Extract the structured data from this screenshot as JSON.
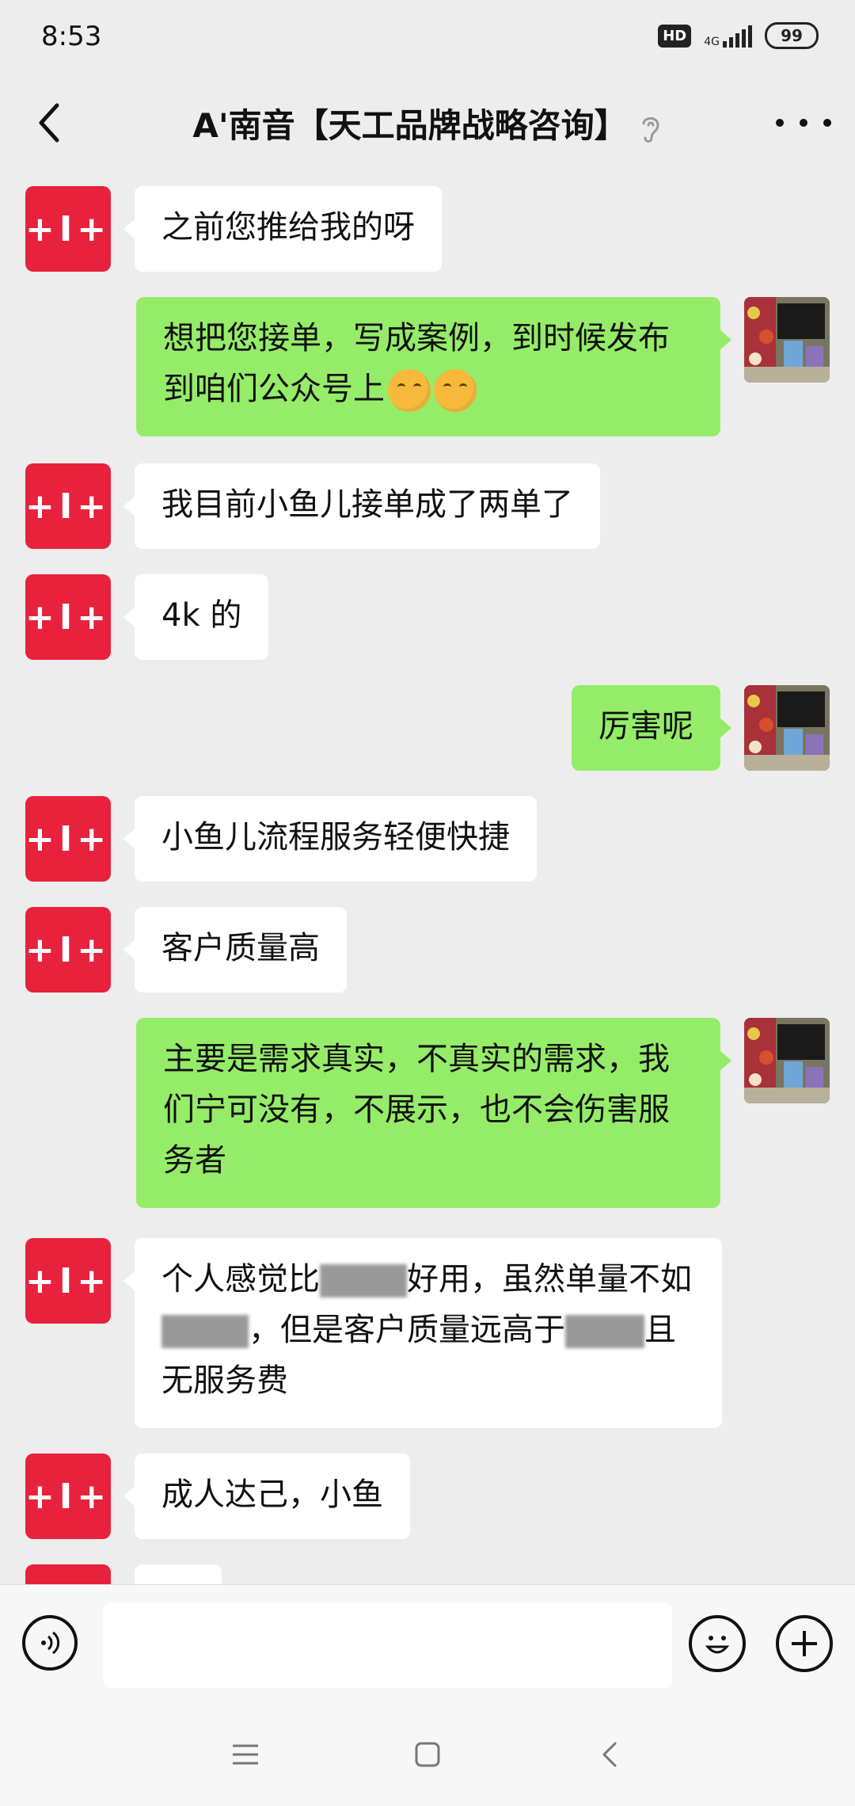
{
  "status_bar": {
    "time": "8:53",
    "hd": "HD",
    "network": "4G",
    "battery": "99"
  },
  "header": {
    "title": "A'南音【天工品牌战略咨询】"
  },
  "messages": [
    {
      "side": "left",
      "segments": [
        {
          "t": "之前您推给我的呀"
        }
      ]
    },
    {
      "side": "right",
      "segments": [
        {
          "t": "想把您接单，写成案例，到时候发布到咱们公众号上"
        }
      ]
    },
    {
      "side": "left",
      "segments": [
        {
          "t": "我目前小鱼儿接单成了两单了"
        }
      ]
    },
    {
      "side": "left",
      "segments": [
        {
          "t": "4k 的"
        }
      ]
    },
    {
      "side": "right",
      "segments": [
        {
          "t": "厉害呢"
        }
      ]
    },
    {
      "side": "left",
      "segments": [
        {
          "t": "小鱼儿流程服务轻便快捷"
        }
      ]
    },
    {
      "side": "left",
      "segments": [
        {
          "t": "客户质量高"
        }
      ]
    },
    {
      "side": "right",
      "segments": [
        {
          "t": "主要是需求真实，不真实的需求，我们宁可没有，不展示，也不会伤害服务者"
        }
      ]
    },
    {
      "side": "left",
      "segments": [
        {
          "t": "个人感觉比"
        },
        {
          "t": "好用，虽然单量不如"
        },
        {
          "t": "，但是客户质量远高于"
        },
        {
          "t": "且无服务费"
        }
      ]
    },
    {
      "side": "left",
      "segments": [
        {
          "t": "成人达己，小鱼"
        }
      ]
    }
  ],
  "avatar_left_text": "+I+",
  "colors": {
    "left_avatar": "#E8223D",
    "right_bubble": "#95EC69",
    "left_bubble": "#FFFFFF",
    "background": "#EDEDED"
  },
  "icons": [
    "back-icon",
    "ear-icon",
    "more-icon",
    "voice-icon",
    "emoji-icon",
    "plus-icon",
    "menu-icon",
    "home-icon",
    "back-nav-icon"
  ]
}
